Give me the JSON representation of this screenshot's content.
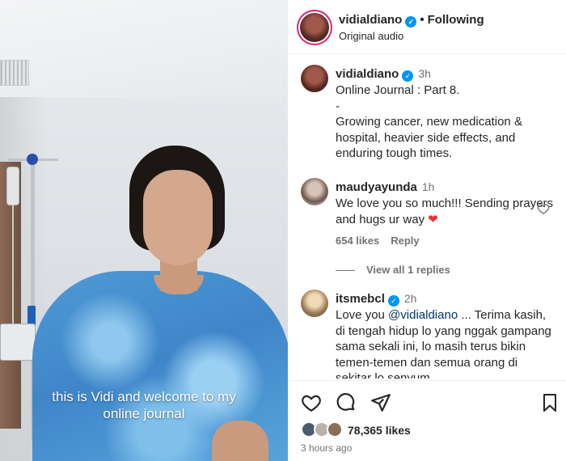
{
  "video": {
    "caption_line1": "this is Vidi and welcome to my",
    "caption_line2": "online journal"
  },
  "header": {
    "username": "vidialdiano",
    "dot": "•",
    "follow_label": "Following",
    "audio": "Original audio"
  },
  "post": {
    "username": "vidialdiano",
    "time": "3h",
    "lines": [
      "Online Journal : Part 8.",
      "-",
      "Growing cancer, new medication &",
      "hospital, heavier side effects, and",
      "enduring tough times."
    ]
  },
  "comments": [
    {
      "username": "maudyayunda",
      "time": "1h",
      "text": "We love you so much!!! Sending prayers and hugs ur way",
      "emoji": "❤",
      "likes": "654 likes",
      "reply": "Reply",
      "view_replies": "View all 1 replies"
    },
    {
      "username": "itsmebcl",
      "time": "2h",
      "text_before": "Love you ",
      "mention": "@vidialdiano",
      "text_after": " ... Terima kasih, di tengah hidup lo yang nggak gampang sama sekali ini, lo masih terus bikin temen-temen dan semua orang di sekitar lo senyum"
    }
  ],
  "footer": {
    "likes": "78,365 likes",
    "time_ago": "3 hours ago"
  },
  "colors": {
    "verified": "#0095f6",
    "heart": "#ed2f33",
    "mention": "#00376b"
  },
  "icons": [
    "heart-icon",
    "comment-icon",
    "share-icon",
    "bookmark-icon",
    "verified-icon"
  ]
}
